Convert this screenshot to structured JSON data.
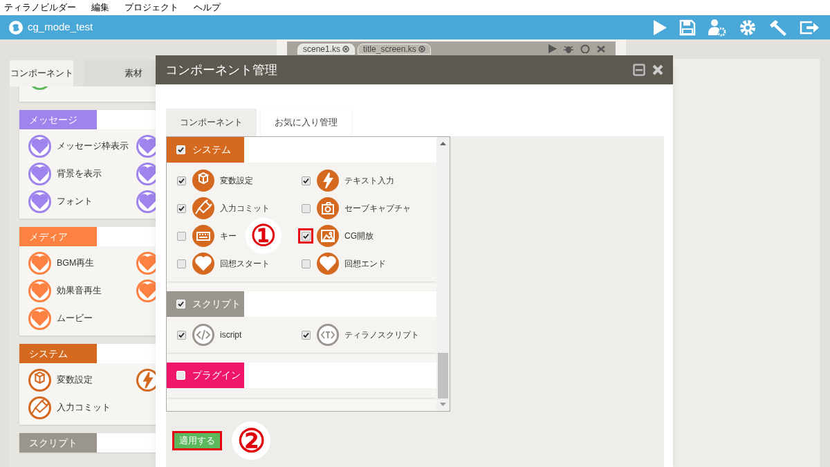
{
  "menu": [
    "ティラノビルダー",
    "編集",
    "プロジェクト",
    "ヘルプ"
  ],
  "header": {
    "project": "cg_mode_test"
  },
  "editor_tabs": [
    {
      "label": "scene1.ks",
      "selected": false
    },
    {
      "label": "title_screen.ks",
      "selected": true
    }
  ],
  "sidebar": {
    "tabs": [
      {
        "label": "コンポーネント",
        "selected": true
      },
      {
        "label": "素材",
        "selected": false
      }
    ],
    "categories": [
      {
        "color": "#5cb85c",
        "items": [
          {
            "kind": "clipped"
          }
        ]
      },
      {
        "title": "メッセージ",
        "color": "#a084ee",
        "items": [
          {
            "label": "メッセージ枠表示"
          },
          {
            "kind": "clipped"
          },
          {
            "label": "背景を表示"
          },
          {
            "kind": "clipped"
          },
          {
            "label": "フォント"
          },
          {
            "kind": "clipped"
          }
        ]
      },
      {
        "title": "メディア",
        "color": "#fd8242",
        "items": [
          {
            "label": "BGM再生"
          },
          {
            "kind": "clipped"
          },
          {
            "label": "効果音再生"
          },
          {
            "kind": "clipped"
          },
          {
            "label": "ムービー"
          }
        ]
      },
      {
        "title": "システム",
        "color": "#d4691f",
        "items": [
          {
            "label": "変数設定"
          },
          {
            "kind": "clipped"
          },
          {
            "label": "入力コミット"
          }
        ]
      },
      {
        "title": "スクリプト",
        "color": "#9a968d"
      }
    ]
  },
  "dialog": {
    "title": "コンポーネント管理",
    "tabs": [
      {
        "label": "コンポーネント",
        "selected": false
      },
      {
        "label": "お気に入り管理",
        "selected": true
      }
    ],
    "groups": [
      {
        "title": "システム",
        "color": "#d4691f",
        "checked": true,
        "items": [
          {
            "label": "変数設定",
            "checked": true,
            "highlighted": false
          },
          {
            "label": "テキスト入力",
            "checked": true,
            "highlighted": false
          },
          {
            "label": "入力コミット",
            "checked": true,
            "highlighted": false
          },
          {
            "label": "セーブキャプチャ",
            "checked": false,
            "highlighted": false
          },
          {
            "label": "キー",
            "checked": false,
            "highlighted": false
          },
          {
            "label": "CG開放",
            "checked": true,
            "highlighted": true
          },
          {
            "label": "回想スタート",
            "checked": false,
            "highlighted": false
          },
          {
            "label": "回想エンド",
            "checked": false,
            "highlighted": false
          }
        ]
      },
      {
        "title": "スクリプト",
        "color": "#9a968d",
        "checked": true,
        "items": [
          {
            "label": "iscript",
            "checked": true,
            "highlighted": false
          },
          {
            "label": "ティラノスクリプト",
            "checked": true,
            "highlighted": false
          }
        ]
      },
      {
        "title": "プラグイン",
        "color": "#f0176b",
        "checked": false
      }
    ],
    "apply_button": {
      "label": "適用する",
      "highlighted": true
    }
  },
  "annotations": [
    {
      "text": "①"
    },
    {
      "text": "②"
    }
  ]
}
